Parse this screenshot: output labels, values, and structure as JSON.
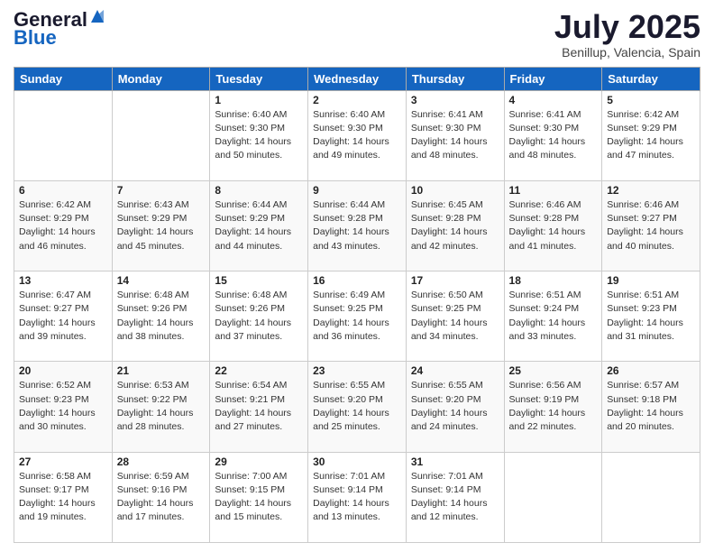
{
  "logo": {
    "line1": "General",
    "line2": "Blue"
  },
  "header": {
    "month": "July 2025",
    "location": "Benillup, Valencia, Spain"
  },
  "days_of_week": [
    "Sunday",
    "Monday",
    "Tuesday",
    "Wednesday",
    "Thursday",
    "Friday",
    "Saturday"
  ],
  "weeks": [
    [
      {
        "day": "",
        "info": ""
      },
      {
        "day": "",
        "info": ""
      },
      {
        "day": "1",
        "sunrise": "6:40 AM",
        "sunset": "9:30 PM",
        "daylight": "14 hours and 50 minutes."
      },
      {
        "day": "2",
        "sunrise": "6:40 AM",
        "sunset": "9:30 PM",
        "daylight": "14 hours and 49 minutes."
      },
      {
        "day": "3",
        "sunrise": "6:41 AM",
        "sunset": "9:30 PM",
        "daylight": "14 hours and 48 minutes."
      },
      {
        "day": "4",
        "sunrise": "6:41 AM",
        "sunset": "9:30 PM",
        "daylight": "14 hours and 48 minutes."
      },
      {
        "day": "5",
        "sunrise": "6:42 AM",
        "sunset": "9:29 PM",
        "daylight": "14 hours and 47 minutes."
      }
    ],
    [
      {
        "day": "6",
        "sunrise": "6:42 AM",
        "sunset": "9:29 PM",
        "daylight": "14 hours and 46 minutes."
      },
      {
        "day": "7",
        "sunrise": "6:43 AM",
        "sunset": "9:29 PM",
        "daylight": "14 hours and 45 minutes."
      },
      {
        "day": "8",
        "sunrise": "6:44 AM",
        "sunset": "9:29 PM",
        "daylight": "14 hours and 44 minutes."
      },
      {
        "day": "9",
        "sunrise": "6:44 AM",
        "sunset": "9:28 PM",
        "daylight": "14 hours and 43 minutes."
      },
      {
        "day": "10",
        "sunrise": "6:45 AM",
        "sunset": "9:28 PM",
        "daylight": "14 hours and 42 minutes."
      },
      {
        "day": "11",
        "sunrise": "6:46 AM",
        "sunset": "9:28 PM",
        "daylight": "14 hours and 41 minutes."
      },
      {
        "day": "12",
        "sunrise": "6:46 AM",
        "sunset": "9:27 PM",
        "daylight": "14 hours and 40 minutes."
      }
    ],
    [
      {
        "day": "13",
        "sunrise": "6:47 AM",
        "sunset": "9:27 PM",
        "daylight": "14 hours and 39 minutes."
      },
      {
        "day": "14",
        "sunrise": "6:48 AM",
        "sunset": "9:26 PM",
        "daylight": "14 hours and 38 minutes."
      },
      {
        "day": "15",
        "sunrise": "6:48 AM",
        "sunset": "9:26 PM",
        "daylight": "14 hours and 37 minutes."
      },
      {
        "day": "16",
        "sunrise": "6:49 AM",
        "sunset": "9:25 PM",
        "daylight": "14 hours and 36 minutes."
      },
      {
        "day": "17",
        "sunrise": "6:50 AM",
        "sunset": "9:25 PM",
        "daylight": "14 hours and 34 minutes."
      },
      {
        "day": "18",
        "sunrise": "6:51 AM",
        "sunset": "9:24 PM",
        "daylight": "14 hours and 33 minutes."
      },
      {
        "day": "19",
        "sunrise": "6:51 AM",
        "sunset": "9:23 PM",
        "daylight": "14 hours and 31 minutes."
      }
    ],
    [
      {
        "day": "20",
        "sunrise": "6:52 AM",
        "sunset": "9:23 PM",
        "daylight": "14 hours and 30 minutes."
      },
      {
        "day": "21",
        "sunrise": "6:53 AM",
        "sunset": "9:22 PM",
        "daylight": "14 hours and 28 minutes."
      },
      {
        "day": "22",
        "sunrise": "6:54 AM",
        "sunset": "9:21 PM",
        "daylight": "14 hours and 27 minutes."
      },
      {
        "day": "23",
        "sunrise": "6:55 AM",
        "sunset": "9:20 PM",
        "daylight": "14 hours and 25 minutes."
      },
      {
        "day": "24",
        "sunrise": "6:55 AM",
        "sunset": "9:20 PM",
        "daylight": "14 hours and 24 minutes."
      },
      {
        "day": "25",
        "sunrise": "6:56 AM",
        "sunset": "9:19 PM",
        "daylight": "14 hours and 22 minutes."
      },
      {
        "day": "26",
        "sunrise": "6:57 AM",
        "sunset": "9:18 PM",
        "daylight": "14 hours and 20 minutes."
      }
    ],
    [
      {
        "day": "27",
        "sunrise": "6:58 AM",
        "sunset": "9:17 PM",
        "daylight": "14 hours and 19 minutes."
      },
      {
        "day": "28",
        "sunrise": "6:59 AM",
        "sunset": "9:16 PM",
        "daylight": "14 hours and 17 minutes."
      },
      {
        "day": "29",
        "sunrise": "7:00 AM",
        "sunset": "9:15 PM",
        "daylight": "14 hours and 15 minutes."
      },
      {
        "day": "30",
        "sunrise": "7:01 AM",
        "sunset": "9:14 PM",
        "daylight": "14 hours and 13 minutes."
      },
      {
        "day": "31",
        "sunrise": "7:01 AM",
        "sunset": "9:14 PM",
        "daylight": "14 hours and 12 minutes."
      },
      {
        "day": "",
        "info": ""
      },
      {
        "day": "",
        "info": ""
      }
    ]
  ]
}
